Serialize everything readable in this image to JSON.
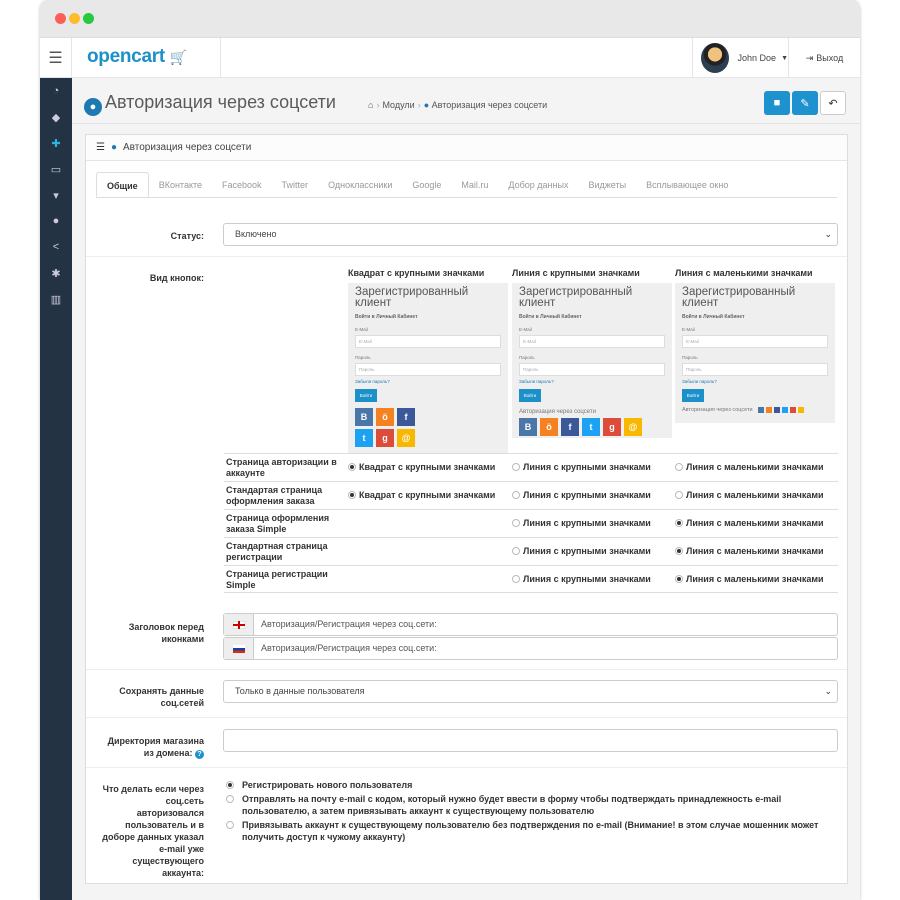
{
  "header": {
    "logo": "opencart",
    "user_name": "John Doe",
    "logout": "Выход"
  },
  "page": {
    "title": "Авторизация через соцсети",
    "breadcrumb": [
      "Модули",
      "Авторизация через соцсети"
    ]
  },
  "panel": {
    "title": "Авторизация через соцсети"
  },
  "tabs": [
    "Общие",
    "ВКонтакте",
    "Facebook",
    "Twitter",
    "Одноклассники",
    "Google",
    "Mail.ru",
    "Добор данных",
    "Виджеты",
    "Всплывающее окно"
  ],
  "status": {
    "label": "Статус:",
    "value": "Включено"
  },
  "buttons_view": {
    "label": "Вид кнопок:",
    "columns": [
      "Квадрат с крупными значками",
      "Линия с крупными значками",
      "Линия с маленькими значками"
    ],
    "preview": {
      "title": "Зарегистрированный клиент",
      "subtitle": "Войти в Личный Кабинет",
      "email_label": "E-Mail",
      "email_placeholder": "E-Mail",
      "password_label": "Пароль",
      "password_placeholder": "Пароль",
      "forgot": "Забыли пароль?",
      "login": "Войти",
      "social": "Авторизация через соцсети"
    },
    "rows": [
      {
        "label": "Страница авторизации в аккаунте",
        "options": [
          "Квадрат с крупными значками",
          "Линия с крупными значками",
          "Линия с маленькими значками"
        ],
        "selected": 0
      },
      {
        "label": "Стандартая страница оформления заказа",
        "options": [
          "Квадрат с крупными значками",
          "Линия с крупными значками",
          "Линия с маленькими значками"
        ],
        "selected": 0
      },
      {
        "label": "Страница оформления заказа Simple",
        "options": [
          "",
          "Линия с крупными значками",
          "Линия с маленькими значками"
        ],
        "selected": 2
      },
      {
        "label": "Стандартная страница регистрации",
        "options": [
          "",
          "Линия с крупными значками",
          "Линия с маленькими значками"
        ],
        "selected": 2
      },
      {
        "label": "Страница регистрации Simple",
        "options": [
          "",
          "Линия с крупными значками",
          "Линия с маленькими значками"
        ],
        "selected": 2
      }
    ]
  },
  "heading": {
    "label": "Заголовок перед иконками",
    "value_en": "Авторизация/Регистрация через соц.сети:",
    "value_ru": "Авторизация/Регистрация через соц.сети:"
  },
  "save_data": {
    "label": "Сохранять данные соц.сетей",
    "value": "Только в данные пользователя"
  },
  "shop_dir": {
    "label": "Директория магазина из домена:",
    "value": ""
  },
  "action": {
    "label": "Что делать если через соц.сеть авторизовался пользователь и в доборе данных указал e-mail уже существующего аккаунта:",
    "options": [
      "Регистрировать нового пользователя",
      "Отправлять на почту e-mail с кодом, который нужно будет ввести в форму чтобы подтверждать принадлежность e-mail пользователю, а затем привязывать аккаунт к существующему пользователю",
      "Привязывать аккаунт к существующему пользователю без подтверждения по e-mail (Внимание! в этом случае мошенник может получить доступ к чужому аккаунту)"
    ],
    "selected": 0
  },
  "colors": {
    "accent": "#1e91cf",
    "sidebar": "#243343",
    "vk": "#4a76a8",
    "ok": "#f58220",
    "fb": "#3b5998",
    "tw": "#1da1f2",
    "gp": "#dd4b39",
    "mail": "#f9b800"
  }
}
